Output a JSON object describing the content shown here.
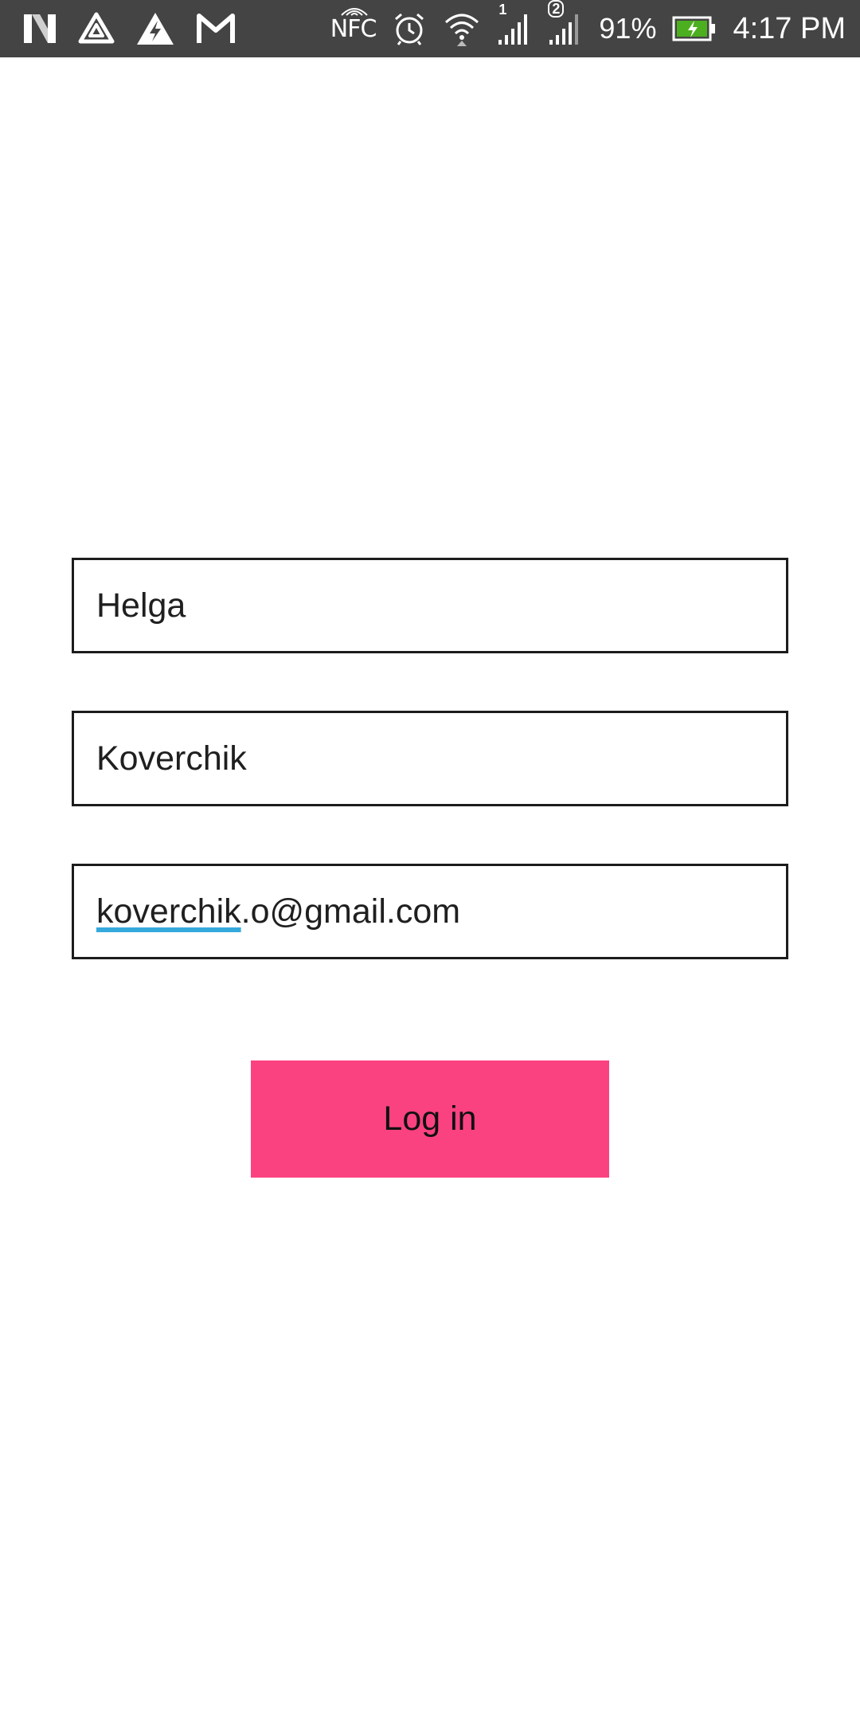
{
  "status_bar": {
    "nfc_label": "NFC",
    "sim1_label": "1",
    "sim2_label": "2",
    "battery_percent": "91%",
    "time": "4:17 PM",
    "icons": [
      "n-app-icon",
      "drive-icon",
      "bolt-app-icon",
      "gmail-icon",
      "nfc-icon",
      "alarm-icon",
      "wifi-icon",
      "signal-sim1-icon",
      "signal-sim2-icon",
      "battery-charging-icon"
    ]
  },
  "form": {
    "first_name_value": "Helga",
    "last_name_value": "Koverchik",
    "email_value_underlined": "koverchik",
    "email_value_rest": ".o@gmail.com"
  },
  "login_button_label": "Log in",
  "colors": {
    "status_bar_bg": "#444444",
    "button_bg": "#fb4281",
    "spellcheck_underline": "#35a9dc",
    "battery_fill": "#4caf1f"
  }
}
